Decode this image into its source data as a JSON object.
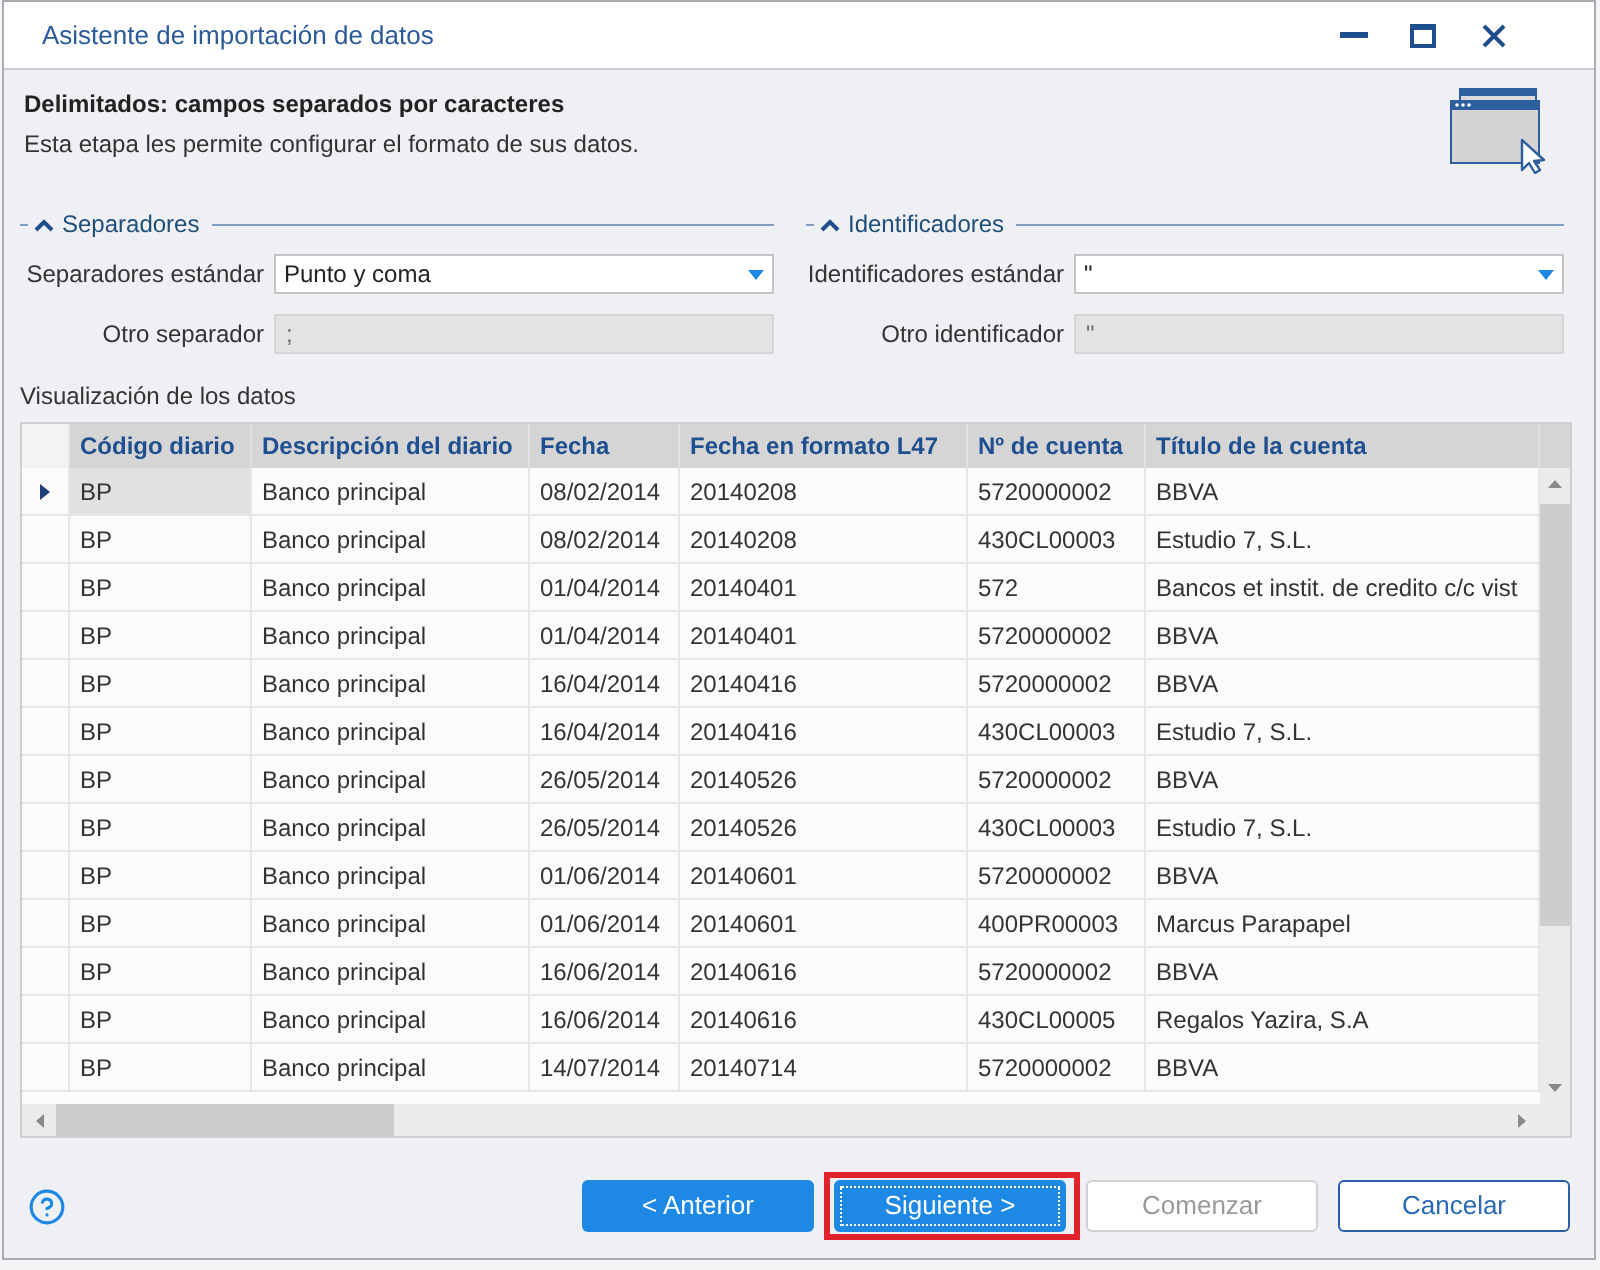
{
  "window": {
    "title": "Asistente de importación de datos"
  },
  "header": {
    "title": "Delimitados: campos separados por caracteres",
    "description": "Esta etapa les permite configurar el formato de sus datos."
  },
  "groups": [
    {
      "title": "Separadores",
      "expanded": true,
      "fields": [
        {
          "label": "Separadores estándar",
          "kind": "dropdown",
          "value": "Punto y coma",
          "disabled": false
        },
        {
          "label": "Otro separador",
          "kind": "text",
          "value": ";",
          "disabled": true
        }
      ]
    },
    {
      "title": "Identificadores",
      "expanded": true,
      "fields": [
        {
          "label": "Identificadores estándar",
          "kind": "dropdown",
          "value": "\"",
          "disabled": false
        },
        {
          "label": "Otro identificador",
          "kind": "text",
          "value": "\"",
          "disabled": true
        }
      ]
    }
  ],
  "preview": {
    "title": "Visualización de los datos",
    "columns": [
      "Código diario",
      "Descripción del diario",
      "Fecha",
      "Fecha en formato L47",
      "Nº de cuenta",
      "Título de la cuenta"
    ],
    "rows": [
      {
        "selected": true,
        "cells": [
          "BP",
          "Banco principal",
          "08/02/2014",
          "20140208",
          "5720000002",
          "BBVA"
        ]
      },
      {
        "selected": false,
        "cells": [
          "BP",
          "Banco principal",
          "08/02/2014",
          "20140208",
          "430CL00003",
          "Estudio 7, S.L."
        ]
      },
      {
        "selected": false,
        "cells": [
          "BP",
          "Banco principal",
          "01/04/2014",
          "20140401",
          "572",
          "Bancos et instit. de credito c/c vist"
        ]
      },
      {
        "selected": false,
        "cells": [
          "BP",
          "Banco principal",
          "01/04/2014",
          "20140401",
          "5720000002",
          "BBVA"
        ]
      },
      {
        "selected": false,
        "cells": [
          "BP",
          "Banco principal",
          "16/04/2014",
          "20140416",
          "5720000002",
          "BBVA"
        ]
      },
      {
        "selected": false,
        "cells": [
          "BP",
          "Banco principal",
          "16/04/2014",
          "20140416",
          "430CL00003",
          "Estudio 7, S.L."
        ]
      },
      {
        "selected": false,
        "cells": [
          "BP",
          "Banco principal",
          "26/05/2014",
          "20140526",
          "5720000002",
          "BBVA"
        ]
      },
      {
        "selected": false,
        "cells": [
          "BP",
          "Banco principal",
          "26/05/2014",
          "20140526",
          "430CL00003",
          "Estudio 7, S.L."
        ]
      },
      {
        "selected": false,
        "cells": [
          "BP",
          "Banco principal",
          "01/06/2014",
          "20140601",
          "5720000002",
          "BBVA"
        ]
      },
      {
        "selected": false,
        "cells": [
          "BP",
          "Banco principal",
          "01/06/2014",
          "20140601",
          "400PR00003",
          "Marcus Parapapel"
        ]
      },
      {
        "selected": false,
        "cells": [
          "BP",
          "Banco principal",
          "16/06/2014",
          "20140616",
          "5720000002",
          "BBVA"
        ]
      },
      {
        "selected": false,
        "cells": [
          "BP",
          "Banco principal",
          "16/06/2014",
          "20140616",
          "430CL00005",
          "Regalos Yazira, S.A"
        ]
      },
      {
        "selected": false,
        "cells": [
          "BP",
          "Banco principal",
          "14/07/2014",
          "20140714",
          "5720000002",
          "BBVA"
        ]
      }
    ]
  },
  "buttons": [
    {
      "label": "< Anterior",
      "kind": "primary",
      "disabled": false,
      "focused": false,
      "highlighted": false
    },
    {
      "label": "Siguiente >",
      "kind": "primary",
      "disabled": false,
      "focused": true,
      "highlighted": true
    },
    {
      "label": "Comenzar",
      "kind": "secondary",
      "disabled": true,
      "focused": false,
      "highlighted": false
    },
    {
      "label": "Cancelar",
      "kind": "secondary",
      "disabled": false,
      "focused": false,
      "highlighted": false
    }
  ]
}
